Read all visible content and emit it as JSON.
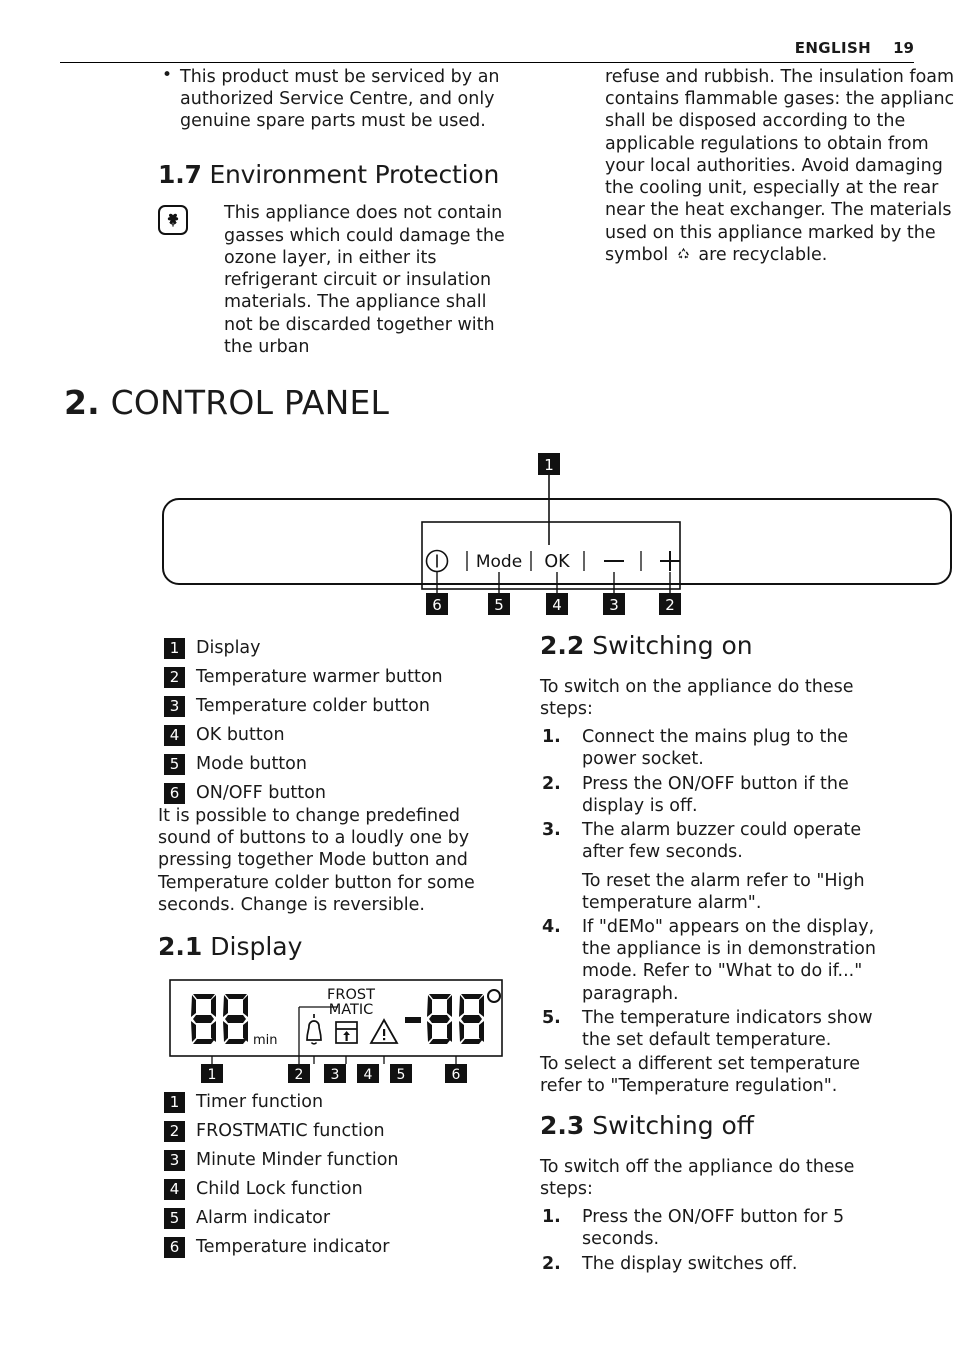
{
  "header": {
    "language": "ENGLISH",
    "page_number": "19"
  },
  "left_column": {
    "bullets": [
      "This product must be serviced by an authorized Service Centre, and only genuine spare parts must be used."
    ],
    "section": {
      "number": "1.7",
      "title": "Environment Protection",
      "icon": "flower-icon",
      "body": "This appliance does not contain gasses which could damage the ozone layer, in either its refrigerant circuit or insulation materials. The appliance shall not be discarded together with the urban"
    }
  },
  "right_column_top": {
    "continuation_before_symbol": "refuse and rubbish. The insulation foam contains flammable gases: the appliance shall be disposed according to the applicable regulations to obtain from your local authorities. Avoid damaging the cooling unit, especially at the rear near the heat exchanger. The materials used on this appliance marked by the symbol",
    "symbol_icon": "recycle-icon",
    "continuation_after_symbol": "are recyclable."
  },
  "chapter": {
    "number": "2.",
    "title": "CONTROL PANEL"
  },
  "control_panel_figure": {
    "callouts_top": [
      {
        "id": "1",
        "target": "display"
      }
    ],
    "buttons": [
      {
        "label": "Ⓘ",
        "icon": "power-icon",
        "callout": "6",
        "name": "on-off-button"
      },
      {
        "label": "Mode",
        "callout": "5",
        "name": "mode-button"
      },
      {
        "label": "OK",
        "callout": "4",
        "name": "ok-button"
      },
      {
        "label": "−",
        "callout": "3",
        "name": "temperature-colder-button"
      },
      {
        "label": "+",
        "callout": "2",
        "name": "temperature-warmer-button"
      }
    ]
  },
  "panel_legend": [
    {
      "n": "1",
      "label": "Display"
    },
    {
      "n": "2",
      "label": "Temperature warmer button"
    },
    {
      "n": "3",
      "label": "Temperature colder button"
    },
    {
      "n": "4",
      "label": "OK button"
    },
    {
      "n": "5",
      "label": "Mode button"
    },
    {
      "n": "6",
      "label": "ON/OFF button"
    }
  ],
  "panel_note": "It is possible to change predefined sound of buttons to a loudly one by pressing together Mode button and Temperature colder button for some seconds. Change is reversible.",
  "display_section": {
    "number": "2.1",
    "title": "Display"
  },
  "display_figure": {
    "timer_digits": "88",
    "timer_unit": "min",
    "frostmatic_line1": "FROST",
    "frostmatic_line2": "MATIC",
    "icons": [
      {
        "name": "bell-icon",
        "callout": "3"
      },
      {
        "name": "child-lock-icon",
        "callout": "4"
      },
      {
        "name": "warning-triangle-icon",
        "callout": "5"
      }
    ],
    "temperature_sign": "−",
    "temperature_digits": "88",
    "degree_symbol": "°",
    "callouts": [
      "1",
      "2",
      "3",
      "4",
      "5",
      "6"
    ]
  },
  "display_legend": [
    {
      "n": "1",
      "label": "Timer function"
    },
    {
      "n": "2",
      "label": "FROSTMATIC function"
    },
    {
      "n": "3",
      "label": "Minute Minder function"
    },
    {
      "n": "4",
      "label": "Child Lock function"
    },
    {
      "n": "5",
      "label": "Alarm indicator"
    },
    {
      "n": "6",
      "label": "Temperature indicator"
    }
  ],
  "switching_on": {
    "number": "2.2",
    "title": "Switching on",
    "intro": "To switch on the appliance do these steps:",
    "steps": [
      {
        "n": "1.",
        "text": "Connect the mains plug to the power socket."
      },
      {
        "n": "2.",
        "text": "Press the ON/OFF button if the display is off."
      },
      {
        "n": "3.",
        "text": "The alarm buzzer could operate after few seconds.",
        "sub": "To reset the alarm refer to \"High temperature alarm\"."
      },
      {
        "n": "4.",
        "text": "If \"dEMo\" appears on the display, the appliance is in demonstration mode. Refer to \"What to do if...\" paragraph."
      },
      {
        "n": "5.",
        "text": "The temperature indicators show the set default temperature."
      }
    ],
    "tail": "To select a different set temperature refer to \"Temperature regulation\"."
  },
  "switching_off": {
    "number": "2.3",
    "title": "Switching off",
    "intro": "To switch off the appliance do these steps:",
    "steps": [
      {
        "n": "1.",
        "text": "Press the ON/OFF button for 5 seconds."
      },
      {
        "n": "2.",
        "text": "The display switches off."
      }
    ]
  },
  "colors": {
    "ink": "#1a1a1a",
    "badge_bg": "#111111",
    "page_bg": "#ffffff"
  }
}
